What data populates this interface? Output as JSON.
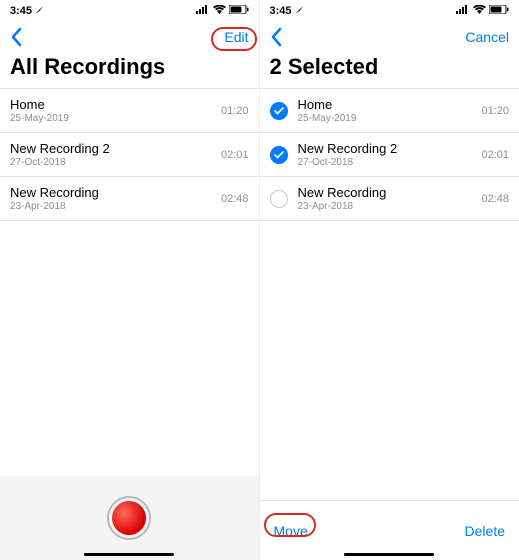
{
  "status": {
    "time": "3:45",
    "location_arrow": "↖"
  },
  "colors": {
    "tint": "#007aff",
    "annotation": "#d62b1f"
  },
  "left": {
    "edit_label": "Edit",
    "title": "All Recordings",
    "recordings": [
      {
        "title": "Home",
        "date": "25-May-2019",
        "duration": "01:20"
      },
      {
        "title": "New Recording 2",
        "date": "27-Oct-2018",
        "duration": "02:01"
      },
      {
        "title": "New Recording",
        "date": "23-Apr-2018",
        "duration": "02:48"
      }
    ]
  },
  "right": {
    "cancel_label": "Cancel",
    "title": "2 Selected",
    "recordings": [
      {
        "title": "Home",
        "date": "25-May-2019",
        "duration": "01:20",
        "selected": true
      },
      {
        "title": "New Recording 2",
        "date": "27-Oct-2018",
        "duration": "02:01",
        "selected": true
      },
      {
        "title": "New Recording",
        "date": "23-Apr-2018",
        "duration": "02:48",
        "selected": false
      }
    ],
    "move_label": "Move",
    "delete_label": "Delete"
  }
}
